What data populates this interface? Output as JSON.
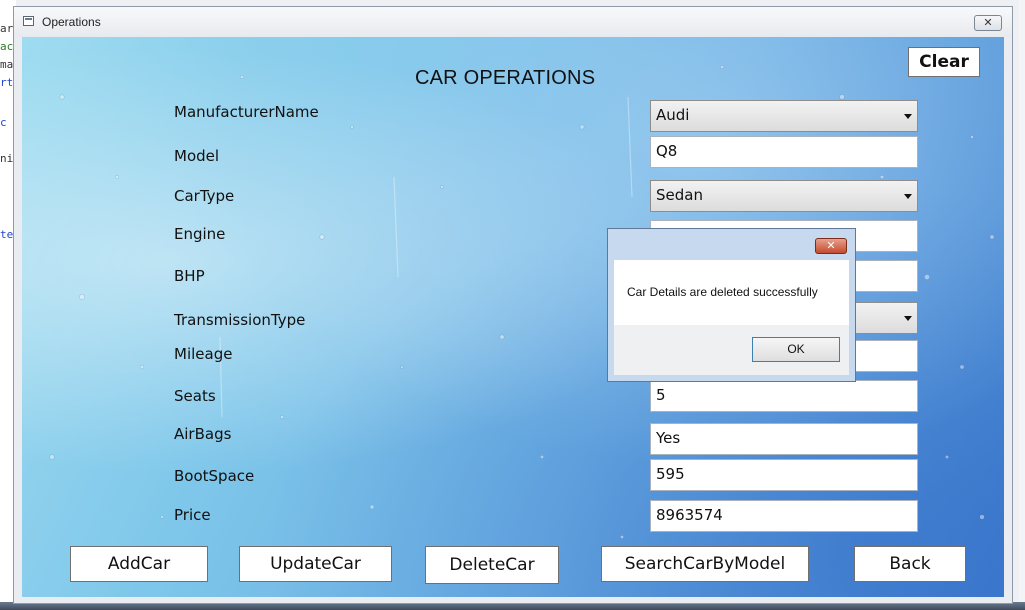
{
  "background": {
    "editor_fragments": [
      "ar",
      "ac",
      "ma",
      "rt",
      "c",
      "ni",
      "te"
    ]
  },
  "window": {
    "title": "Operations",
    "close_glyph": "✕"
  },
  "form": {
    "title": "CAR OPERATIONS",
    "clear_label": "Clear",
    "labels": {
      "manufacturer": "ManufacturerName",
      "model": "Model",
      "car_type": "CarType",
      "engine": "Engine",
      "bhp": "BHP",
      "transmission": "TransmissionType",
      "mileage": "Mileage",
      "seats": "Seats",
      "airbags": "AirBags",
      "bootspace": "BootSpace",
      "price": "Price"
    },
    "values": {
      "manufacturer": "Audi",
      "model": "Q8",
      "car_type": "Sedan",
      "engine": "",
      "bhp": "",
      "transmission": "",
      "mileage": "",
      "seats": "5",
      "airbags": "Yes",
      "bootspace": "595",
      "price": "8963574"
    },
    "buttons": {
      "add": "AddCar",
      "update": "UpdateCar",
      "delete": "DeleteCar",
      "search": "SearchCarByModel",
      "back": "Back"
    }
  },
  "message_box": {
    "close_glyph": "✕",
    "text": "Car Details are deleted successfully",
    "ok_label": "OK"
  },
  "colors": {
    "accent_blue": "#3f7fd0",
    "msg_close_red": "#c44a2e"
  }
}
